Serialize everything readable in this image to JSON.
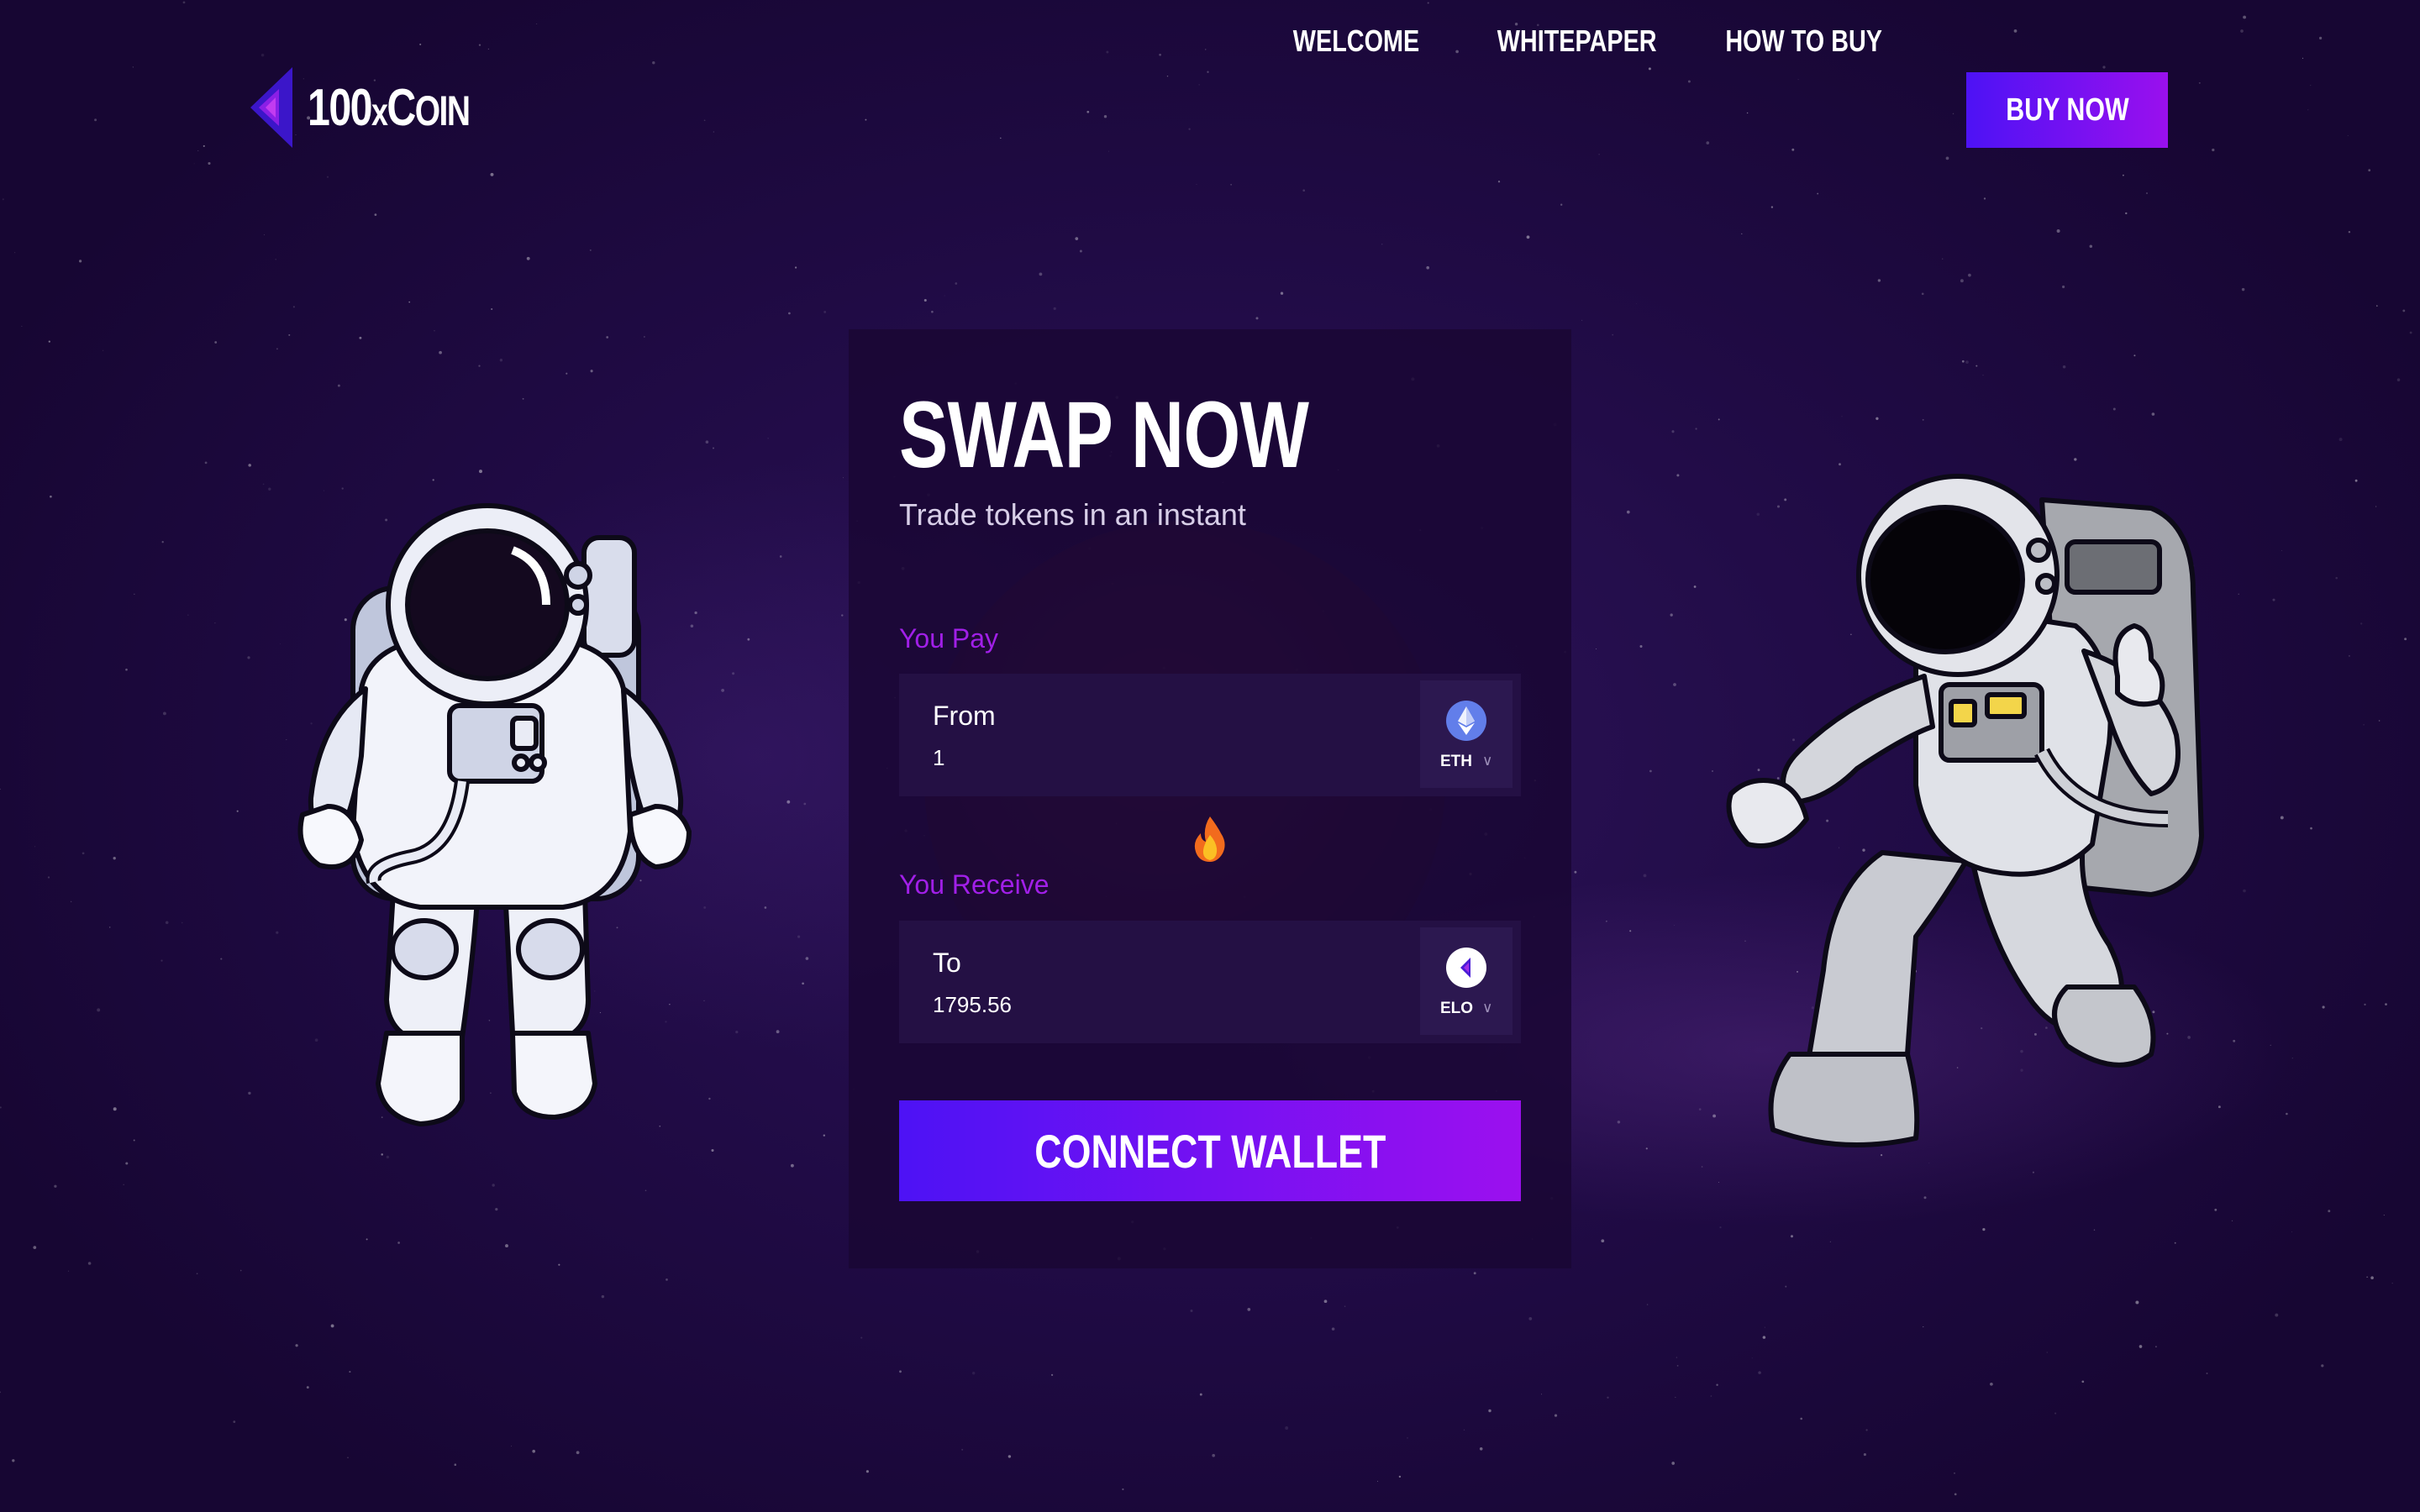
{
  "brand": {
    "name_main": "100",
    "name_x": "x",
    "name_c": "C",
    "name_rest": "OIN",
    "accent_colors": [
      "#4d12f5",
      "#9c10ef"
    ]
  },
  "nav": {
    "links": [
      "WELCOME",
      "WHITEPAPER",
      "HOW TO BUY"
    ],
    "cta_label": "BUY NOW"
  },
  "swap": {
    "title": "SWAP NOW",
    "subtitle": "Trade tokens in an instant",
    "pay": {
      "section_label": "You Pay",
      "box_label": "From",
      "value": "1",
      "token": "ETH",
      "token_icon": "ethereum-icon"
    },
    "divider_icon": "fire-icon",
    "receive": {
      "section_label": "You Receive",
      "box_label": "To",
      "value": "1795.56",
      "token": "ELO",
      "token_icon": "elo-coin-icon"
    },
    "connect_label": "CONNECT WALLET"
  }
}
